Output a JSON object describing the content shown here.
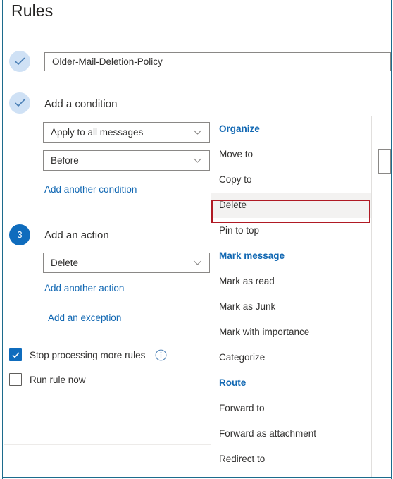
{
  "window": {
    "title": "Rules",
    "accent_color": "#1268b3",
    "frame_border_color": "#1c6b8c",
    "annotation_color": "#b01a24"
  },
  "steps": [
    {
      "id": "rule-name",
      "state": "done",
      "marker": "check",
      "label": "",
      "field": {
        "type": "textbox",
        "value": "Older-Mail-Deletion-Policy",
        "placeholder": "Name your rule"
      }
    },
    {
      "id": "add-condition",
      "state": "done",
      "marker": "check",
      "label": "Add a condition",
      "selects": [
        {
          "name": "condition-type",
          "value": "Apply to all messages"
        },
        {
          "name": "condition-operator",
          "value": "Before"
        }
      ],
      "link": "Add another condition"
    },
    {
      "id": "add-action",
      "state": "active",
      "marker": "3",
      "label": "Add an action",
      "selects": [
        {
          "name": "action-type",
          "value": "Delete"
        }
      ],
      "links": [
        "Add another action",
        "Add an exception"
      ]
    }
  ],
  "options": [
    {
      "name": "stop-processing-more-rules",
      "label": "Stop processing more rules",
      "checked": true,
      "has_info": true
    },
    {
      "name": "run-rule-now",
      "label": "Run rule now",
      "checked": false,
      "has_info": false
    }
  ],
  "action_flyout": {
    "selected": "Delete",
    "entries": [
      {
        "type": "group",
        "label": "Organize"
      },
      {
        "type": "item",
        "label": "Move to"
      },
      {
        "type": "item",
        "label": "Copy to"
      },
      {
        "type": "item",
        "label": "Delete"
      },
      {
        "type": "item",
        "label": "Pin to top"
      },
      {
        "type": "group",
        "label": "Mark message"
      },
      {
        "type": "item",
        "label": "Mark as read"
      },
      {
        "type": "item",
        "label": "Mark as Junk"
      },
      {
        "type": "item",
        "label": "Mark with importance"
      },
      {
        "type": "item",
        "label": "Categorize"
      },
      {
        "type": "group",
        "label": "Route"
      },
      {
        "type": "item",
        "label": "Forward to"
      },
      {
        "type": "item",
        "label": "Forward as attachment"
      },
      {
        "type": "item",
        "label": "Redirect to"
      }
    ]
  },
  "icons": {
    "check": "check-icon",
    "chevron": "chevron-down-icon",
    "info": "info-icon"
  }
}
